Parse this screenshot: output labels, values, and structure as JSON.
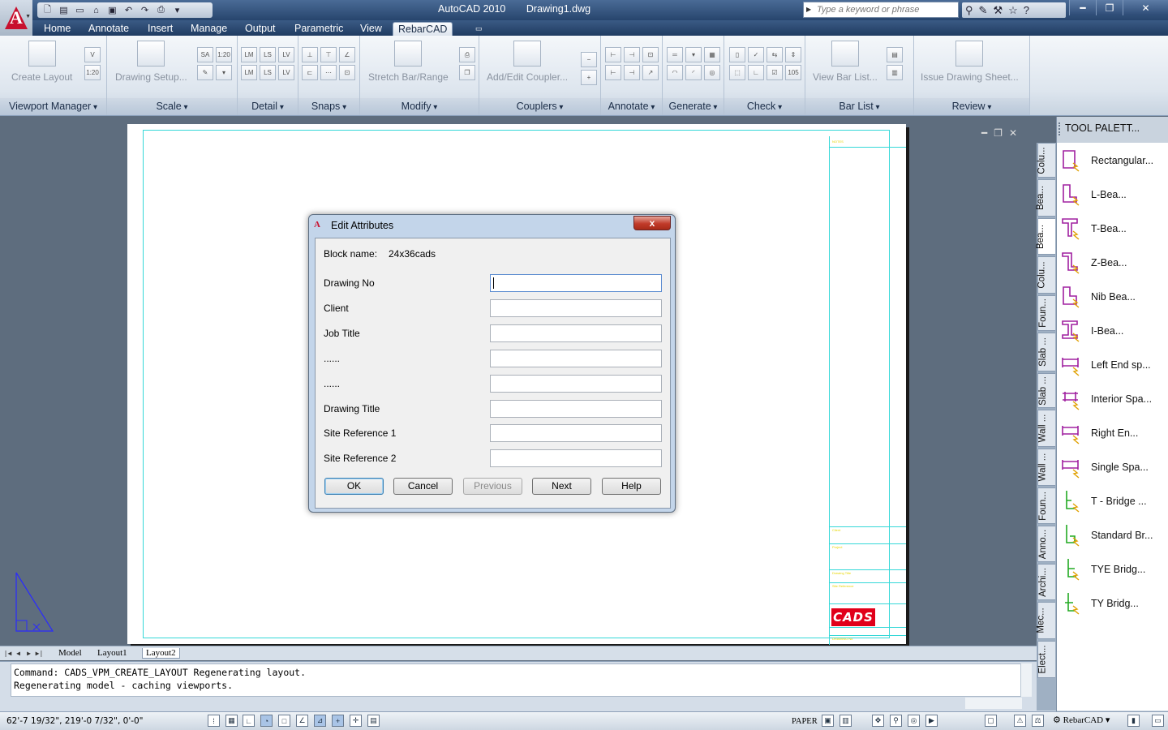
{
  "titlebar": {
    "product": "AutoCAD 2010",
    "document": "Drawing1.dwg",
    "search_placeholder": "Type a keyword or phrase",
    "app_menu_letter": "A"
  },
  "ribbon_tabs": [
    "Home",
    "Annotate",
    "Insert",
    "Manage",
    "Output",
    "Parametric",
    "View",
    "RebarCAD"
  ],
  "active_tab": "RebarCAD",
  "ribbon": {
    "panels": [
      "Viewport Manager",
      "Scale",
      "Detail",
      "Snaps",
      "Modify",
      "Couplers",
      "Annotate",
      "Generate",
      "Check",
      "Bar List",
      "Review"
    ],
    "buttons": {
      "create_layout": "Create Layout",
      "drawing_setup": "Drawing Setup...",
      "stretch_bar": "Stretch Bar/Range",
      "add_coupler": "Add/Edit Coupler...",
      "view_bar_list": "View Bar List...",
      "issue_sheet": "Issue Drawing Sheet..."
    },
    "scale_labels": [
      "SA",
      "1:20"
    ],
    "viewport_labels": [
      "V",
      "1:20"
    ],
    "detail_labels": [
      "LM",
      "LS",
      "LV",
      "LM",
      "LS",
      "LV"
    ],
    "check_label": "105"
  },
  "dialog": {
    "title": "Edit Attributes",
    "close_label": "x",
    "block_label": "Block name:",
    "block_value": "24x36cads",
    "fields": [
      {
        "label": "Drawing No",
        "value": ""
      },
      {
        "label": "Client",
        "value": ""
      },
      {
        "label": "Job Title",
        "value": ""
      },
      {
        "label": "......",
        "value": ""
      },
      {
        "label": "......",
        "value": ""
      },
      {
        "label": "Drawing Title",
        "value": ""
      },
      {
        "label": "Site Reference 1",
        "value": ""
      },
      {
        "label": "Site Reference 2",
        "value": ""
      }
    ],
    "buttons": {
      "ok": "OK",
      "cancel": "Cancel",
      "previous": "Previous",
      "next": "Next",
      "help": "Help"
    }
  },
  "titleblock": {
    "logo": "CADS",
    "notes_label": "NOTES",
    "client_label": "Client",
    "project_label": "Project",
    "drawing_title_label": "Drawing Title",
    "site_ref_label": "Site Reference",
    "drawing_no_label": "DRAWING No"
  },
  "layout_tabs": [
    "Model",
    "Layout1",
    "Layout2"
  ],
  "active_layout": "Layout2",
  "command_line": {
    "line1": "Command: CADS_VPM_CREATE_LAYOUT Regenerating layout.",
    "line2": "Regenerating model - caching viewports."
  },
  "status": {
    "coords": "62'-7 19/32\",  219'-0 7/32\",  0'-0\"",
    "space": "PAPER",
    "workspace": "RebarCAD"
  },
  "palette": {
    "title": "TOOL PALETT...",
    "tabs": [
      "Colu...",
      "Bea...",
      "Bea...",
      "Colu...",
      "Foun...",
      "Slab ...",
      "Slab ...",
      "Wall ...",
      "Wall ...",
      "Foun...",
      "Anno...",
      "Archi...",
      "Mec...",
      "Elect..."
    ],
    "active_tab_index": 2,
    "items": [
      "Rectangular...",
      "L-Bea...",
      "T-Bea...",
      "Z-Bea...",
      "Nib Bea...",
      "I-Bea...",
      "Left End sp...",
      "Interior Spa...",
      "Right En...",
      "Single Spa...",
      "T - Bridge ...",
      "Standard Br...",
      "TYE Bridg...",
      "TY Bridg..."
    ],
    "item_colors": [
      "#a020a0",
      "#a020a0",
      "#a020a0",
      "#a020a0",
      "#a020a0",
      "#a020a0",
      "#a020a0",
      "#a020a0",
      "#a020a0",
      "#a020a0",
      "#22aa22",
      "#22aa22",
      "#22aa22",
      "#22aa22"
    ]
  },
  "colors": {
    "accent": "#c8102e",
    "border_line": "#35d8d8",
    "titleblock_text": "#e6d500"
  }
}
